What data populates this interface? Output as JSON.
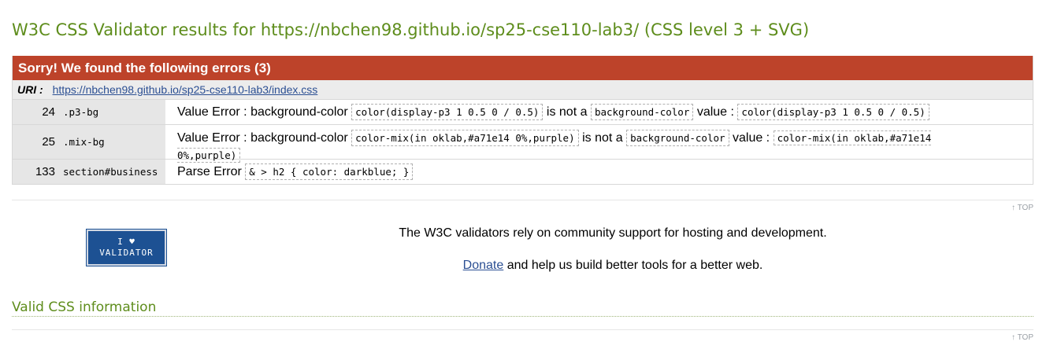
{
  "page": {
    "title": "W3C CSS Validator results for https://nbchen98.github.io/sp25-cse110-lab3/ (CSS level 3 + SVG)"
  },
  "errors": {
    "header": "Sorry! We found the following errors (3)",
    "uri_label": "URI :",
    "uri": "https://nbchen98.github.io/sp25-cse110-lab3/index.css",
    "rows": [
      {
        "line": "24",
        "context": ".p3-bg",
        "type": "Value Error : background-color",
        "value": "color(display-p3 1 0.5 0 / 0.5)",
        "is_not_a": "is not a",
        "property": "background-color",
        "value_label": "value :",
        "value2": "color(display-p3 1 0.5 0 / 0.5)"
      },
      {
        "line": "25",
        "context": ".mix-bg",
        "type": "Value Error : background-color",
        "value": "color-mix(in oklab,#a71e14 0%,purple)",
        "is_not_a": "is not a",
        "property": "background-color",
        "value_label": "value :",
        "value2": "color-mix(in oklab,#a71e14 0%,purple)"
      },
      {
        "line": "133",
        "context": "section#business",
        "type": "Parse Error",
        "value": "& > h2 { color: darkblue; }"
      }
    ]
  },
  "nav": {
    "top_link": "↑ TOP"
  },
  "support": {
    "badge_line1": "I ♥",
    "badge_line2": "VALIDATOR",
    "text": "The W3C validators rely on community support for hosting and development.",
    "donate_link": "Donate",
    "donate_text": " and help us build better tools for a better web."
  },
  "valid_css": {
    "title": "Valid CSS information"
  },
  "colors": {
    "title_green": "#5e8d1c",
    "error_header_red": "#bd432a",
    "link_blue": "#2b4f93",
    "badge_blue": "#1d5193"
  }
}
